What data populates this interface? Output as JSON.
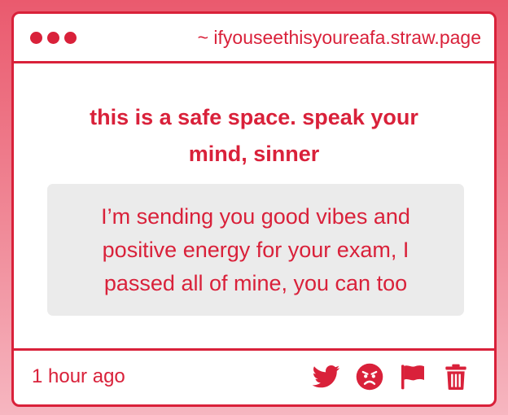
{
  "window": {
    "url": "~ ifyouseethisyoureafa.straw.page"
  },
  "content": {
    "headline": "this is a safe space. speak your mind, sinner",
    "message": "I’m sending you good vibes and positive energy for your exam, I passed all of mine, you can too"
  },
  "footer": {
    "timestamp": "1 hour ago",
    "actions": [
      "twitter-icon",
      "angry-face-icon",
      "flag-icon",
      "trash-icon"
    ]
  },
  "colors": {
    "accent": "#d9213a",
    "message_bg": "#ebebeb",
    "card_bg": "#ffffff"
  }
}
